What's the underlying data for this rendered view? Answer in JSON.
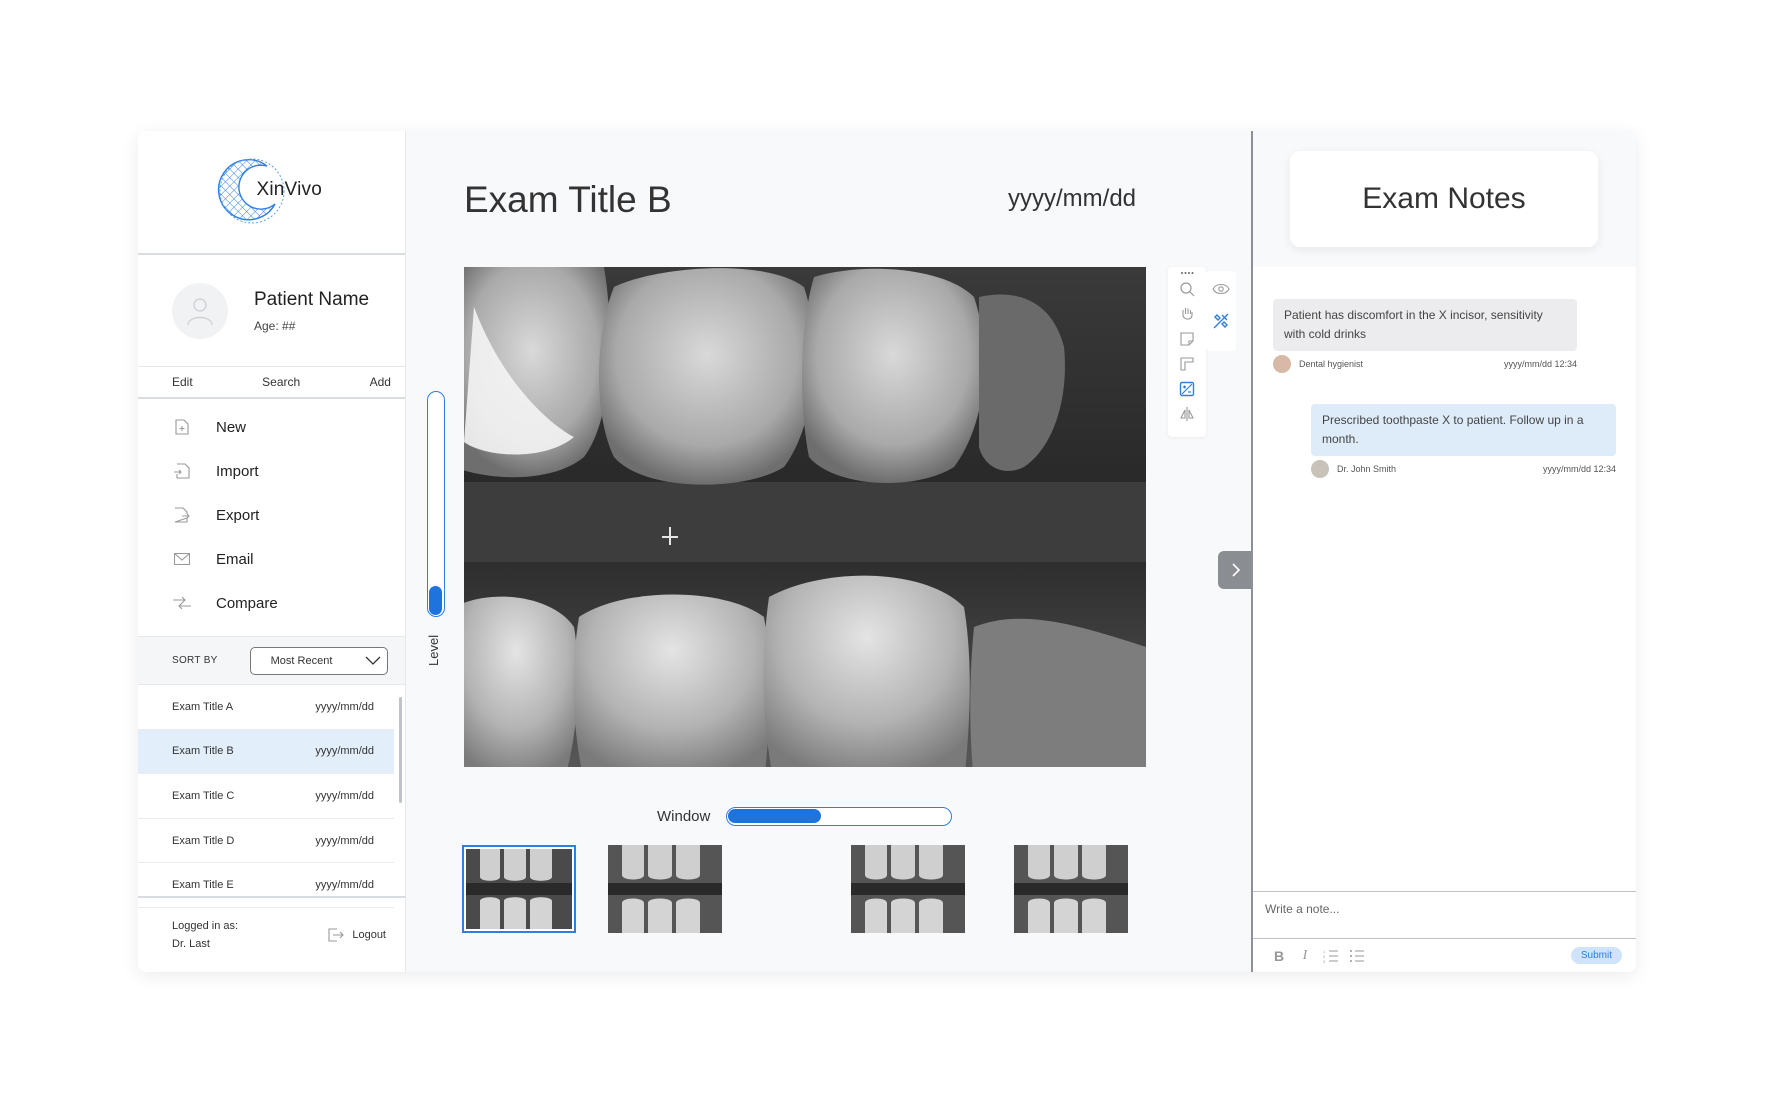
{
  "brand": {
    "name": "XinVivo"
  },
  "patient": {
    "name": "Patient Name",
    "age": "Age: ##"
  },
  "actions": {
    "edit": "Edit",
    "search": "Search",
    "add": "Add"
  },
  "menu": [
    {
      "label": "New",
      "icon": "file-plus-icon"
    },
    {
      "label": "Import",
      "icon": "file-import-icon"
    },
    {
      "label": "Export",
      "icon": "file-export-icon"
    },
    {
      "label": "Email",
      "icon": "envelope-icon"
    },
    {
      "label": "Compare",
      "icon": "compare-arrows-icon"
    }
  ],
  "sort": {
    "label": "SORT BY",
    "selected": "Most Recent"
  },
  "exams": [
    {
      "title": "Exam Title A",
      "date": "yyyy/mm/dd"
    },
    {
      "title": "Exam Title B",
      "date": "yyyy/mm/dd",
      "selected": true
    },
    {
      "title": "Exam Title C",
      "date": "yyyy/mm/dd"
    },
    {
      "title": "Exam Title D",
      "date": "yyyy/mm/dd"
    },
    {
      "title": "Exam Title E",
      "date": "yyyy/mm/dd"
    }
  ],
  "footer": {
    "logged_label": "Logged in as:",
    "user": "Dr. Last",
    "logout": "Logout"
  },
  "main": {
    "title": "Exam Title B",
    "date": "yyyy/mm/dd",
    "level_label": "Level",
    "level_value": 0.13,
    "window_label": "Window",
    "window_value": 0.42
  },
  "tools": [
    "zoom-icon",
    "pan-hand-icon",
    "annotate-icon",
    "measure-icon",
    "contrast-icon",
    "flip-icon",
    "visibility-eye-icon",
    "tooth-tool-icon"
  ],
  "notes": {
    "title": "Exam Notes",
    "items": [
      {
        "text": "Patient has discomfort in the X incisor, sensitivity with cold drinks",
        "author": "Dental hygienist",
        "time": "yyyy/mm/dd 12:34"
      },
      {
        "text": "Prescribed toothpaste X to patient.  Follow up in a month.",
        "author": "Dr. John Smith",
        "time": "yyyy/mm/dd 12:34"
      }
    ],
    "placeholder": "Write a note...",
    "format": {
      "bold": "B",
      "italic": "I"
    },
    "submit": "Submit"
  },
  "colors": {
    "accent": "#1f73dd",
    "selected_row": "#e3eefb",
    "note_blue": "#deecfa"
  }
}
